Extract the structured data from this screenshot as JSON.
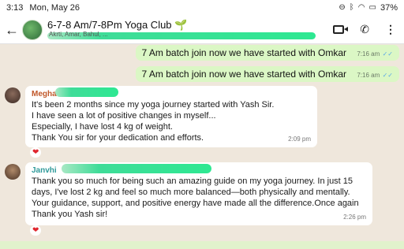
{
  "status_bar": {
    "time": "3:13",
    "date": "Mon, May 26",
    "battery": "37%"
  },
  "header": {
    "title": "6-7-8 Am/7-8Pm Yoga Club 🌱",
    "subtitle": "Akrti, Amar, Bahul, ...",
    "icons": {
      "back": "back-arrow-icon",
      "video": "video-call-icon",
      "call": "phone-call-icon",
      "menu": "more-menu-icon"
    }
  },
  "messages": [
    {
      "type": "outgoing",
      "text": "7 Am batch join now we have started with Omkar",
      "time": "7:16 am",
      "ticks": "✓✓"
    },
    {
      "type": "outgoing",
      "text": "7 Am batch join now we have started with Omkar",
      "time": "7:16 am",
      "ticks": "✓✓"
    },
    {
      "type": "incoming",
      "sender": "Megha",
      "sender_color": "#c0582a",
      "lines": [
        "It's been 2 months since my yoga journey started with Yash Sir.",
        "I have seen a lot of positive changes in myself...",
        "Especially, I have lost 4 kg of weight.",
        "Thank You sir for your dedication and efforts."
      ],
      "time": "2:09 pm",
      "reaction": "❤"
    },
    {
      "type": "incoming",
      "sender": "Janvhi",
      "sender_color": "#2f9a9a",
      "lines": [
        "Thank you so much for being such an amazing guide on my yoga journey. In just 15",
        "days, I've lost 2 kg and feel so much more balanced—both physically and mentally.",
        "Your guidance, support, and positive energy have made all the difference.Once again",
        "Thank you Yash sir!"
      ],
      "time": "2:26 pm",
      "reaction": "❤"
    }
  ]
}
